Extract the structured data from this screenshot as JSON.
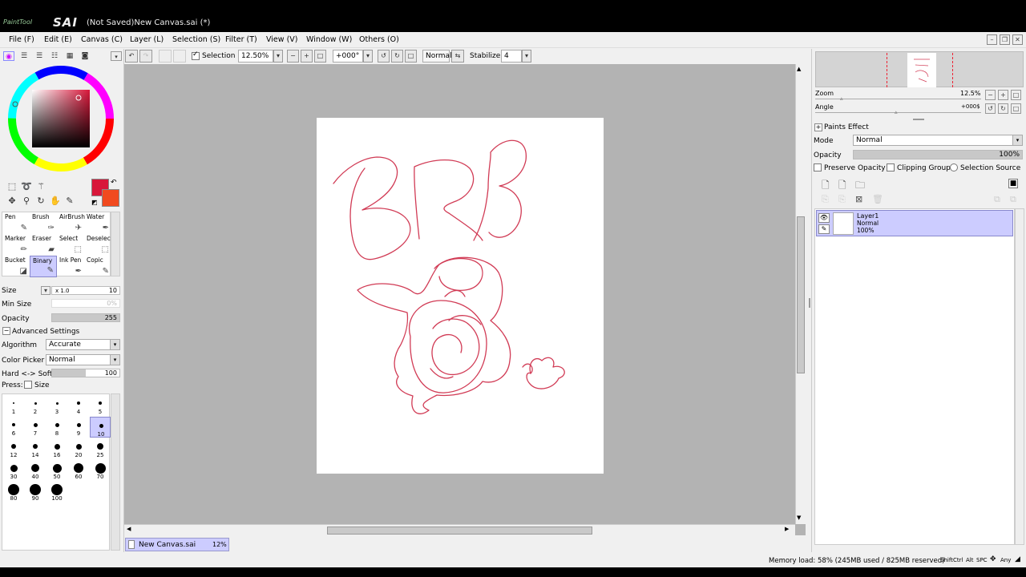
{
  "app": {
    "logo_small": "PaintTool",
    "logo_big": "SAI",
    "window_title": "(Not Saved)New Canvas.sai (*)"
  },
  "menu": [
    "File (F)",
    "Edit (E)",
    "Canvas (C)",
    "Layer (L)",
    "Selection (S)",
    "Filter (T)",
    "View (V)",
    "Window (W)",
    "Others (O)"
  ],
  "window_buttons": {
    "minimize": "–",
    "restore": "❐",
    "close": "✕"
  },
  "toolbar": {
    "selection_label": "Selection",
    "zoom": "12.50%",
    "angle": "+000°",
    "mode": "Normal",
    "stabilizer_label": "Stabilizer",
    "stabilizer": "4"
  },
  "tools": {
    "size_label": "Size",
    "size_multiplier": "x 1.0",
    "size_value": "10",
    "min_size_label": "Min Size",
    "min_size_value": "0%",
    "opacity_label": "Opacity",
    "opacity_value": "255",
    "advanced_label": "Advanced Settings",
    "algorithm_label": "Algorithm",
    "algorithm_value": "Accurate",
    "color_picker_label": "Color Picker",
    "color_picker_value": "Normal",
    "hardsoft_label": "Hard <-> Soft",
    "hardsoft_value": "100",
    "press_label": "Press:",
    "press_size_label": "Size",
    "brushes": [
      {
        "label": "Pen",
        "icon": "✎"
      },
      {
        "label": "Brush",
        "icon": "✑"
      },
      {
        "label": "AirBrush",
        "icon": "✈"
      },
      {
        "label": "Water",
        "icon": "✒"
      },
      {
        "label": "Marker",
        "icon": "✏"
      },
      {
        "label": "Eraser",
        "icon": "▰"
      },
      {
        "label": "Select",
        "icon": "⬚"
      },
      {
        "label": "Deselect",
        "icon": "⬚"
      },
      {
        "label": "Bucket",
        "icon": "◪"
      },
      {
        "label": "Binary",
        "icon": "✎"
      },
      {
        "label": "Ink Pen",
        "icon": "✒"
      },
      {
        "label": "Copic",
        "icon": "✎"
      }
    ],
    "brush_sizes": [
      "1",
      "2",
      "3",
      "4",
      "5",
      "6",
      "7",
      "8",
      "9",
      "10",
      "12",
      "14",
      "16",
      "20",
      "25",
      "30",
      "40",
      "50",
      "60",
      "70",
      "80",
      "90",
      "100"
    ],
    "selected_size": "10"
  },
  "colors": {
    "primary": "#d8173a",
    "secondary": "#f14a1f",
    "ui_accent": "#ccccff"
  },
  "navigator": {
    "zoom_label": "Zoom",
    "zoom_value": "12.5%",
    "angle_label": "Angle",
    "angle_value": "+000$"
  },
  "layers_panel": {
    "paints_effect_label": "Paints Effect",
    "mode_label": "Mode",
    "mode_value": "Normal",
    "opacity_label": "Opacity",
    "opacity_value": "100%",
    "preserve_opacity_label": "Preserve Opacity",
    "clipping_group_label": "Clipping Group",
    "selection_source_label": "Selection Source",
    "layers": [
      {
        "name": "Layer1",
        "mode": "Normal",
        "opacity": "100%"
      }
    ]
  },
  "canvas_tabs": [
    {
      "name": "New Canvas.sai",
      "zoom": "12%"
    }
  ],
  "status": {
    "memory": "Memory load: 58% (245MB used / 825MB reserved)",
    "keys": [
      "Shift",
      "Ctrl",
      "Alt",
      "SPC",
      "Any"
    ]
  }
}
